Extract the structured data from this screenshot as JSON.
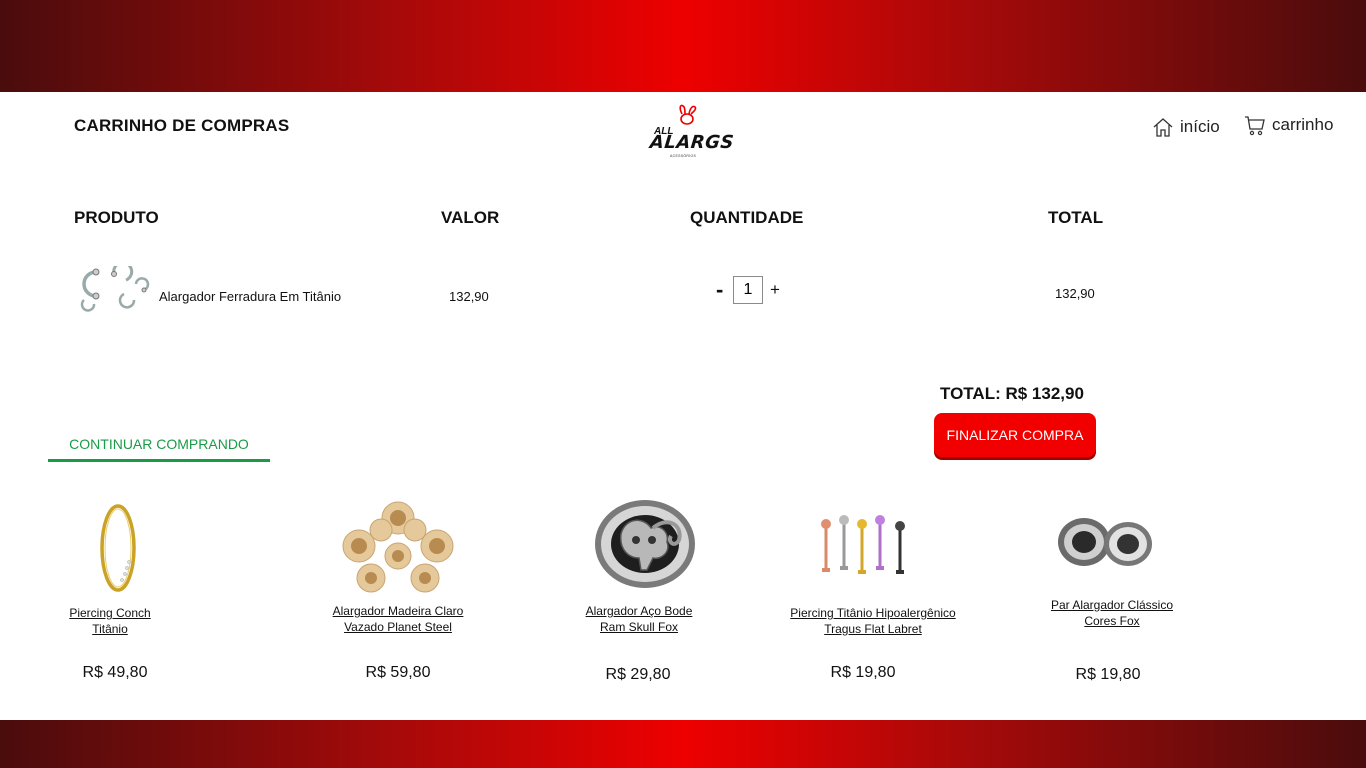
{
  "header": {
    "title": "CARRINHO DE COMPRAS",
    "logo": {
      "small": "ALL",
      "brand": "ALARGS",
      "tagline": "ACESSÓRIOS"
    },
    "nav": [
      {
        "label": "início",
        "icon": "home-icon"
      },
      {
        "label": "carrinho",
        "icon": "cart-icon"
      }
    ]
  },
  "cart": {
    "columns": [
      "PRODUTO",
      "VALOR",
      "QUANTIDADE",
      "TOTAL"
    ],
    "items": [
      {
        "name": "Alargador Ferradura Em Titânio",
        "price": "132,90",
        "quantity": "1",
        "total": "132,90"
      }
    ],
    "qty_minus": "-",
    "qty_plus": "+"
  },
  "summary": {
    "total_label": "TOTAL: R$ 132,90",
    "checkout_label": "FINALIZAR COMPRA"
  },
  "continue_label": "CONTINUAR COMPRANDO",
  "suggestions": [
    {
      "title": "Piercing Conch Titânio",
      "price": "R$ 49,80"
    },
    {
      "title": "Alargador Madeira Claro Vazado Planet Steel",
      "price": "R$ 59,80"
    },
    {
      "title": "Alargador Aço Bode Ram Skull Fox",
      "price": "R$ 29,80"
    },
    {
      "title": "Piercing Titânio Hipoalergênico Tragus Flat Labret",
      "price": "R$ 19,80"
    },
    {
      "title": "Par Alargador Clássico Cores Fox",
      "price": "R$ 19,80"
    }
  ],
  "colors": {
    "band": "#ee0000",
    "accent": "#f20000",
    "continue": "#1a9b48"
  }
}
